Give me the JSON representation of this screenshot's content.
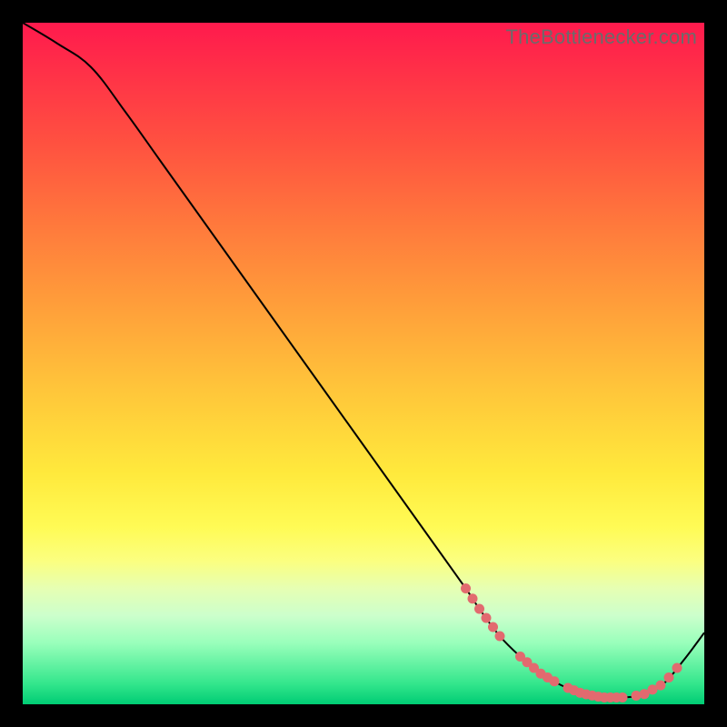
{
  "watermark": "TheBottlenecker.com",
  "colors": {
    "curve": "#000000",
    "marker": "#e26a6f"
  },
  "chart_data": {
    "type": "line",
    "title": "",
    "xlabel": "",
    "ylabel": "",
    "xlim": [
      0,
      100
    ],
    "ylim": [
      0,
      100
    ],
    "series": [
      {
        "name": "bottleneck-curve",
        "x": [
          0,
          5,
          10,
          15,
          20,
          25,
          30,
          35,
          40,
          45,
          50,
          55,
          60,
          65,
          67,
          70,
          73,
          76,
          79,
          82,
          85,
          88,
          91,
          94,
          97,
          100
        ],
        "y": [
          100,
          97,
          93.5,
          87,
          80,
          73,
          66,
          59,
          52,
          45,
          38,
          31,
          24,
          17,
          14,
          10,
          7,
          4.5,
          2.8,
          1.6,
          1.0,
          1.0,
          1.4,
          3.0,
          6.5,
          10.5
        ]
      }
    ],
    "markers": [
      {
        "name": "cluster-left",
        "x_start": 65,
        "x_end": 70,
        "count": 6,
        "y": 8
      },
      {
        "name": "cluster-mid-a",
        "x_start": 73,
        "x_end": 78,
        "count": 6,
        "y": 2.5
      },
      {
        "name": "cluster-mid-b",
        "x_start": 80,
        "x_end": 88,
        "count": 10,
        "y": 1.0
      },
      {
        "name": "cluster-right",
        "x_start": 90,
        "x_end": 96,
        "count": 6,
        "y": 4.0
      }
    ]
  }
}
